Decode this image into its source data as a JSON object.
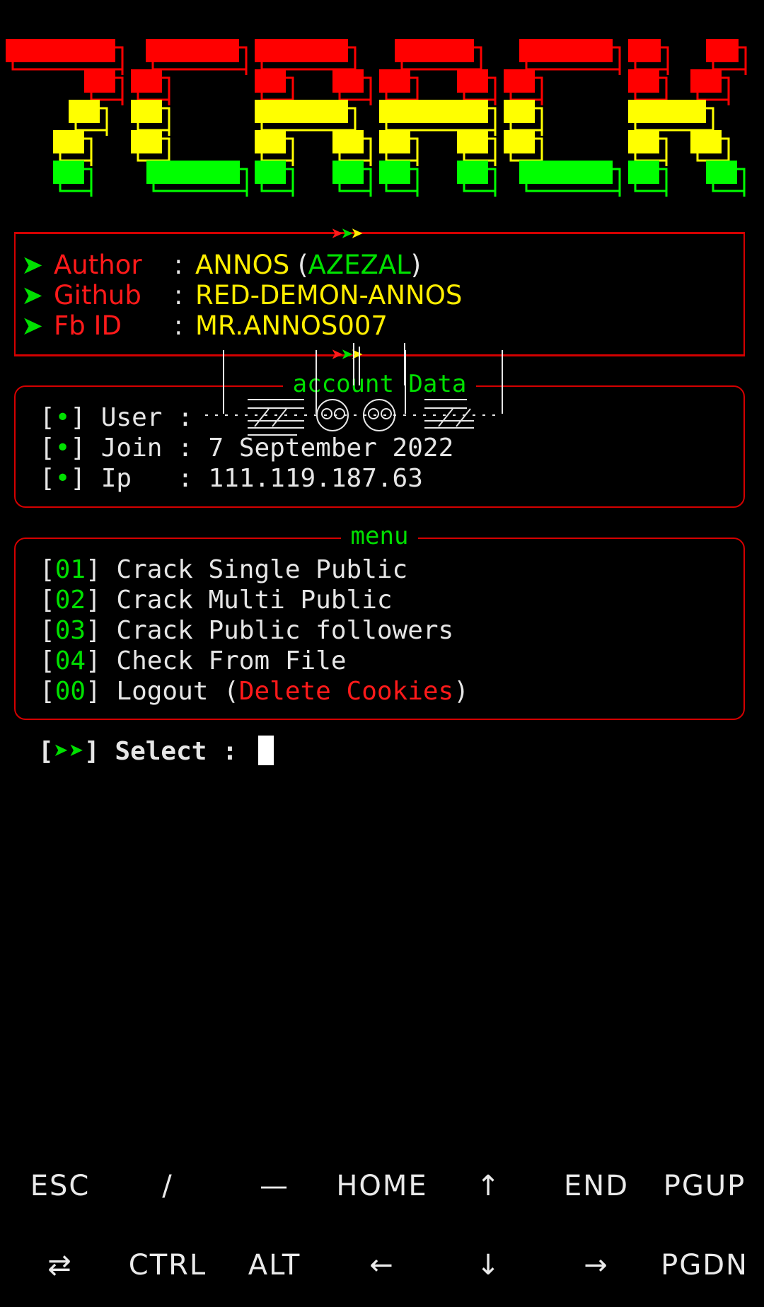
{
  "banner": {
    "text": "TCRACK",
    "colors": [
      "#ff0000",
      "#ffff00",
      "#00ff00"
    ]
  },
  "author_box": {
    "rows": [
      {
        "key": "Author",
        "value": "ANNOS",
        "paren_open": " (",
        "value_alt": "AZEZAL",
        "paren_close": ")"
      },
      {
        "key": "Github",
        "value": "RED-DEMON-ANNOS"
      },
      {
        "key": "Fb ID",
        "value": "MR.ANNOS007"
      }
    ],
    "arrow": "➤",
    "colon": ":"
  },
  "account": {
    "title": "account Data",
    "rows": [
      {
        "bullet": "•",
        "label": "User ",
        "sep": ": ",
        "value": ""
      },
      {
        "bullet": "•",
        "label": "Join ",
        "sep": ": ",
        "value": "7 September 2022"
      },
      {
        "bullet": "•",
        "label": "Ip   ",
        "sep": ": ",
        "value": "111.119.187.63"
      }
    ]
  },
  "menu": {
    "title": "menu",
    "items": [
      {
        "num": "01",
        "label": "Crack Single Public"
      },
      {
        "num": "02",
        "label": "Crack Multi Public"
      },
      {
        "num": "03",
        "label": "Crack Public followers"
      },
      {
        "num": "04",
        "label": "Check From File"
      },
      {
        "num": "00",
        "label": "Logout (",
        "extra": "Delete Cookies",
        "close": ")"
      }
    ]
  },
  "prompt": {
    "arrows": "➤➤",
    "label": "Select : "
  },
  "extra_keys": {
    "row1": [
      "ESC",
      "/",
      "—",
      "HOME",
      "↑",
      "END",
      "PGUP"
    ],
    "row2": [
      "⇄",
      "CTRL",
      "ALT",
      "←",
      "↓",
      "→",
      "PGDN"
    ]
  }
}
